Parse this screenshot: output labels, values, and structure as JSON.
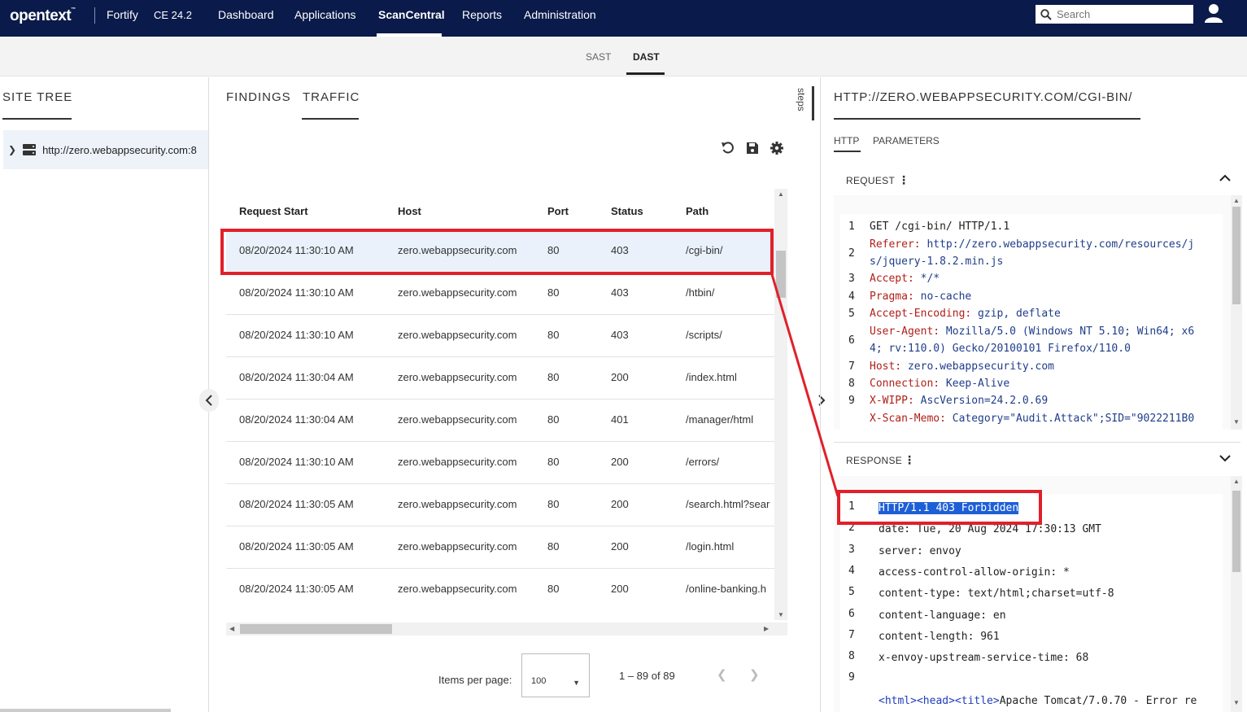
{
  "nav": {
    "logo": "opentext",
    "logo_tm": "™",
    "product": "Fortify",
    "version": "CE 24.2",
    "items": [
      "Dashboard",
      "Applications",
      "ScanCentral",
      "Reports",
      "Administration"
    ],
    "active": "ScanCentral",
    "search_placeholder": "Search"
  },
  "subtabs": {
    "sast": "SAST",
    "dast": "DAST",
    "active": "DAST"
  },
  "site_tree": {
    "title": "SITE TREE",
    "items": [
      {
        "label": "http://zero.webappsecurity.com:8"
      }
    ]
  },
  "middle": {
    "tabs": [
      "FINDINGS",
      "TRAFFIC"
    ],
    "active_tab": "TRAFFIC",
    "steps_label": "steps",
    "icons": [
      "refresh-icon",
      "save-icon",
      "gear-icon"
    ],
    "columns": [
      "Request Start",
      "Host",
      "Port",
      "Status",
      "Path"
    ],
    "rows": [
      [
        "08/20/2024 11:30:10 AM",
        "zero.webappsecurity.com",
        "80",
        "403",
        "/cgi-bin/"
      ],
      [
        "08/20/2024 11:30:10 AM",
        "zero.webappsecurity.com",
        "80",
        "403",
        "/htbin/"
      ],
      [
        "08/20/2024 11:30:10 AM",
        "zero.webappsecurity.com",
        "80",
        "403",
        "/scripts/"
      ],
      [
        "08/20/2024 11:30:04 AM",
        "zero.webappsecurity.com",
        "80",
        "200",
        "/index.html"
      ],
      [
        "08/20/2024 11:30:04 AM",
        "zero.webappsecurity.com",
        "80",
        "401",
        "/manager/html"
      ],
      [
        "08/20/2024 11:30:10 AM",
        "zero.webappsecurity.com",
        "80",
        "200",
        "/errors/"
      ],
      [
        "08/20/2024 11:30:05 AM",
        "zero.webappsecurity.com",
        "80",
        "200",
        "/search.html?sear"
      ],
      [
        "08/20/2024 11:30:05 AM",
        "zero.webappsecurity.com",
        "80",
        "200",
        "/login.html"
      ],
      [
        "08/20/2024 11:30:05 AM",
        "zero.webappsecurity.com",
        "80",
        "200",
        "/online-banking.h"
      ]
    ],
    "selected_row": 0,
    "pager": {
      "label": "Items per page:",
      "value": "100",
      "range": "1 – 89 of 89"
    }
  },
  "detail": {
    "url": "HTTP://ZERO.WEBAPPSECURITY.COM/CGI-BIN/",
    "tabs": [
      "HTTP",
      "PARAMETERS"
    ],
    "active_tab": "HTTP",
    "request": {
      "title": "REQUEST",
      "lines": [
        {
          "n": "1",
          "text": "GET /cgi-bin/ HTTP/1.1"
        },
        {
          "n": "2",
          "key": "Referer:",
          "val": " http://zero.webappsecurity.com/resources/j",
          "cont": "s/jquery-1.8.2.min.js"
        },
        {
          "n": "3",
          "key": "Accept:",
          "val": " */*"
        },
        {
          "n": "4",
          "key": "Pragma:",
          "val": " no-cache"
        },
        {
          "n": "5",
          "key": "Accept-Encoding:",
          "val": " gzip, deflate"
        },
        {
          "n": "6",
          "key": "User-Agent:",
          "val": " Mozilla/5.0 (Windows NT 5.10; Win64; x6",
          "cont": "4; rv:110.0) Gecko/20100101 Firefox/110.0"
        },
        {
          "n": "7",
          "key": "Host:",
          "val": " zero.webappsecurity.com"
        },
        {
          "n": "8",
          "key": "Connection:",
          "val": " Keep-Alive"
        },
        {
          "n": "9",
          "key": "X-WIPP:",
          "val": " AscVersion=24.2.0.69"
        },
        {
          "n": "",
          "key": "X-Scan-Memo:",
          "val": " Category=\"Audit.Attack\";SID=\"9022211B0"
        }
      ]
    },
    "response": {
      "title": "RESPONSE",
      "lines": [
        {
          "n": "1",
          "text": "HTTP/1.1 403 Forbidden"
        },
        {
          "n": "2",
          "text": "date: Tue, 20 Aug 2024 17:30:13 GMT"
        },
        {
          "n": "3",
          "text": "server: envoy"
        },
        {
          "n": "4",
          "text": "access-control-allow-origin: *"
        },
        {
          "n": "5",
          "text": "content-type: text/html;charset=utf-8"
        },
        {
          "n": "6",
          "text": "content-language: en"
        },
        {
          "n": "7",
          "text": "content-length: 961"
        },
        {
          "n": "8",
          "text": "x-envoy-upstream-service-time: 68"
        },
        {
          "n": "9",
          "text": ""
        }
      ],
      "html_tags": "<html><head><title>",
      "html_text": "Apache Tomcat/7.0.70 - Error re"
    }
  },
  "colors": {
    "nav_bg": "#0a1a4a",
    "highlight_box": "#e0202a",
    "selection": "#1f5fd6"
  }
}
